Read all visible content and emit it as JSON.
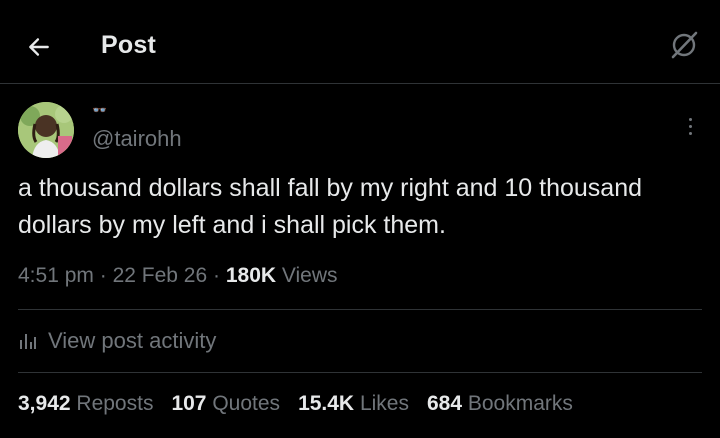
{
  "header": {
    "title": "Post",
    "back_icon": "arrow-left-icon",
    "grok_icon": "grok-icon"
  },
  "author": {
    "display_name": "👓",
    "handle": "@tairohh"
  },
  "tweet": {
    "text": "a thousand dollars shall fall by my right and 10 thousand dollars by my left and i shall pick them."
  },
  "meta": {
    "time": "4:51 pm",
    "date": "22 Feb 26",
    "views_count": "180K",
    "views_label": "Views",
    "separator": "·"
  },
  "activity": {
    "label": "View post activity",
    "icon": "bar-chart-icon"
  },
  "stats": {
    "reposts_count": "3,942",
    "reposts_label": "Reposts",
    "quotes_count": "107",
    "quotes_label": "Quotes",
    "likes_count": "15.4K",
    "likes_label": "Likes",
    "bookmarks_count": "684",
    "bookmarks_label": "Bookmarks"
  },
  "colors": {
    "background": "#000000",
    "primary_text": "#e7e9ea",
    "secondary_text": "#71767b",
    "divider": "#2f3336"
  }
}
